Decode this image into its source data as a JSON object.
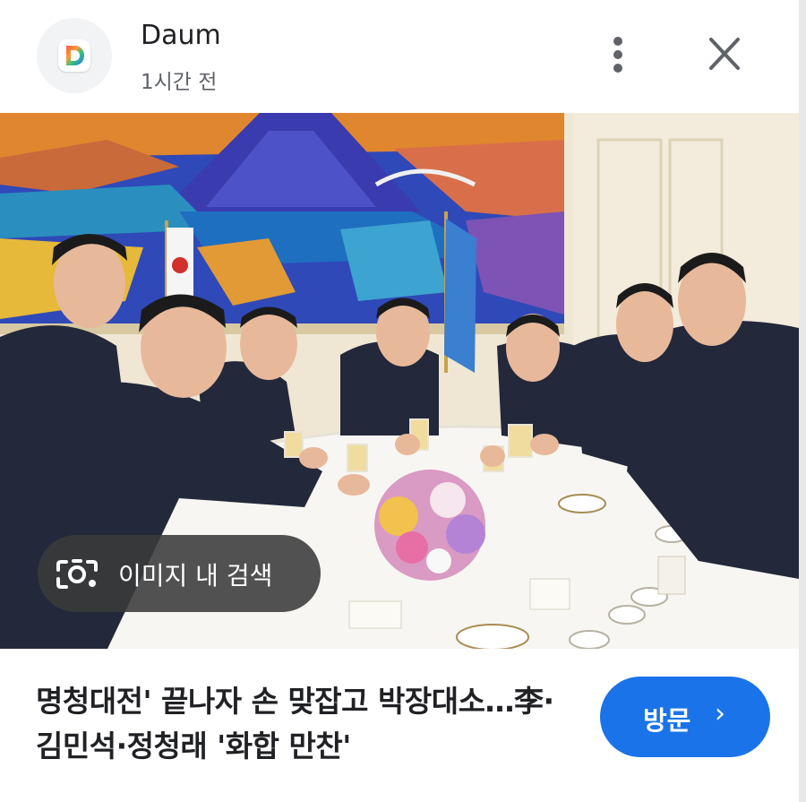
{
  "header": {
    "source_name": "Daum",
    "time_ago": "1시간 전",
    "more_icon": "more-vert-icon",
    "close_icon": "close-icon"
  },
  "image": {
    "description_icon": "news-photo",
    "lens_chip_label": "이미지 내 검색",
    "lens_icon": "google-lens-icon"
  },
  "article": {
    "caption": "명청대전' 끝나자 손 맞잡고 박장대소…李·김민석·정청래 '화합 만찬'"
  },
  "actions": {
    "visit_label": "방문",
    "visit_chevron": "›"
  },
  "colors": {
    "accent": "#1a73e8",
    "text": "#202124",
    "secondary_text": "#5f6368"
  }
}
